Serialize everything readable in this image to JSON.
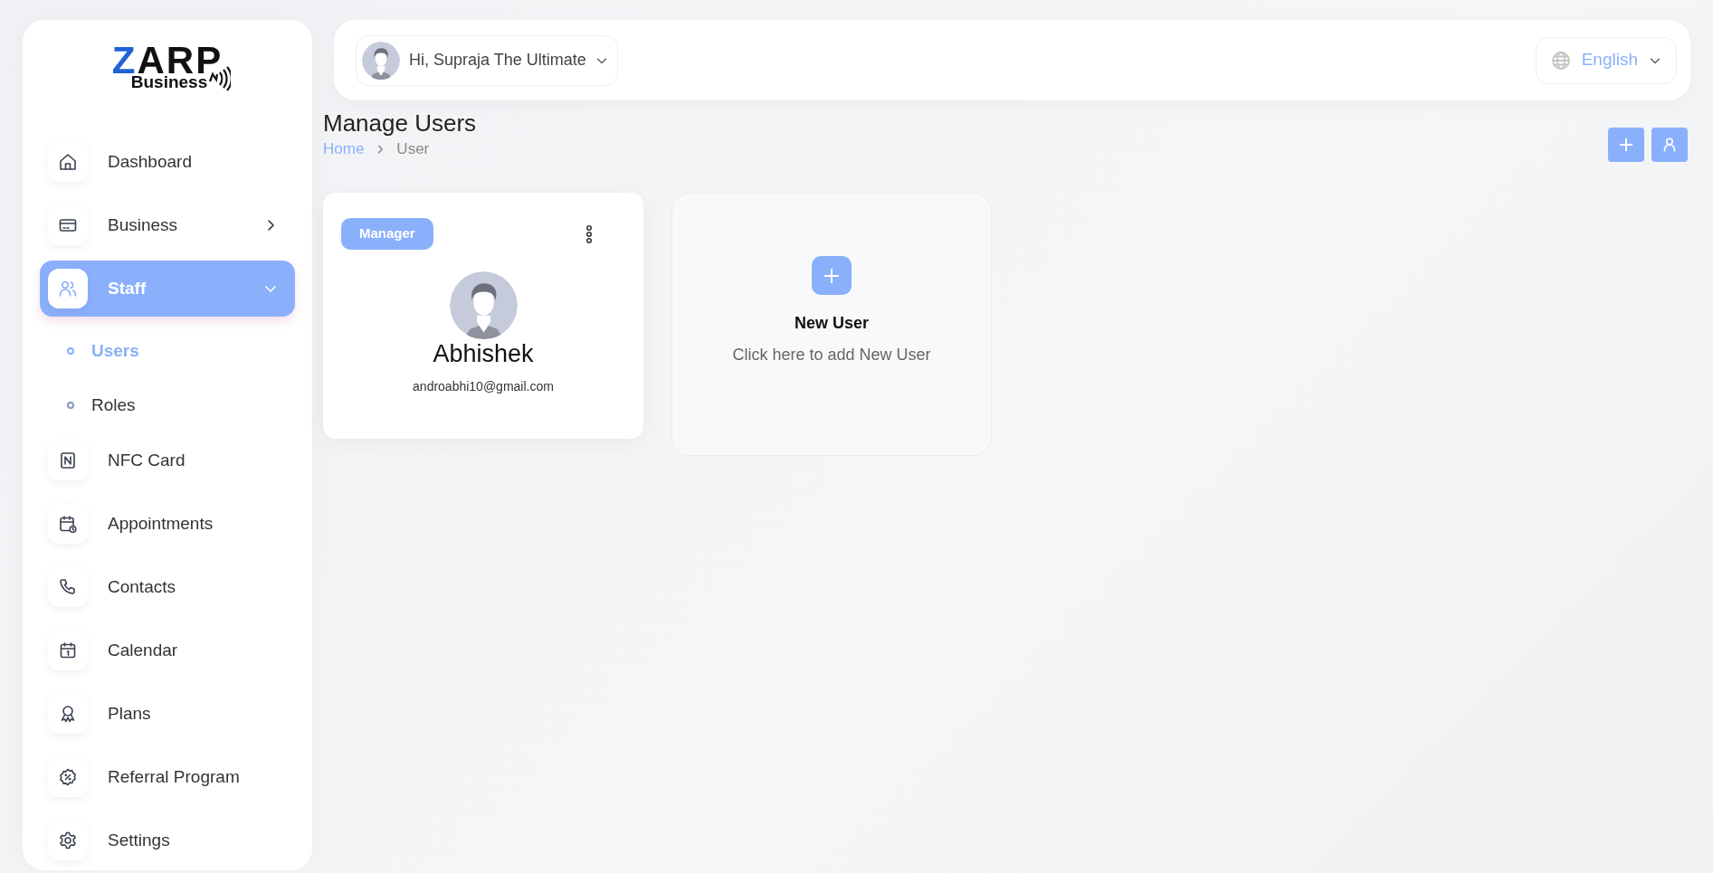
{
  "logo": {
    "accent": "Z",
    "brand": "ARP",
    "sub": "Business"
  },
  "sidebar": {
    "items": [
      {
        "label": "Dashboard",
        "kind": "link",
        "selected": false
      },
      {
        "label": "Business",
        "kind": "group",
        "selected": false,
        "expanded": false
      },
      {
        "label": "Staff",
        "kind": "group",
        "selected": true,
        "expanded": true,
        "children": [
          {
            "label": "Users",
            "selected": true
          },
          {
            "label": "Roles",
            "selected": false
          }
        ]
      },
      {
        "label": "NFC Card",
        "kind": "link",
        "selected": false
      },
      {
        "label": "Appointments",
        "kind": "link",
        "selected": false
      },
      {
        "label": "Contacts",
        "kind": "link",
        "selected": false
      },
      {
        "label": "Calendar",
        "kind": "link",
        "selected": false
      },
      {
        "label": "Plans",
        "kind": "link",
        "selected": false
      },
      {
        "label": "Referral Program",
        "kind": "link",
        "selected": false
      },
      {
        "label": "Settings",
        "kind": "link",
        "selected": false
      }
    ]
  },
  "header": {
    "greeting": "Hi, Supraja The Ultimate",
    "language": "English"
  },
  "page": {
    "title": "Manage Users",
    "breadcrumb": [
      {
        "label": "Home",
        "kind": "link"
      },
      {
        "label": "User",
        "kind": "current"
      }
    ]
  },
  "users": [
    {
      "role": "Manager",
      "name": "Abhishek",
      "email": "androabhi10@gmail.com"
    }
  ],
  "new_user": {
    "title": "New User",
    "subtitle": "Click here to add New User"
  }
}
